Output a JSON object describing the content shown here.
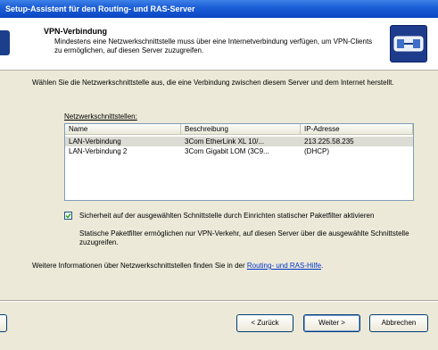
{
  "window": {
    "title": "Setup-Assistent für den Routing- und RAS-Server"
  },
  "header": {
    "title": "VPN-Verbindung",
    "description": "Mindestens eine Netzwerkschnittstelle muss über eine Internetverbindung verfügen, um VPN-Clients zu ermöglichen, auf diesen Server zuzugreifen.",
    "icon": "vpn-network-icon"
  },
  "intro": "Wählen Sie die Netzwerkschnittstelle aus, die eine Verbindung zwischen diesem Server und dem Internet herstellt.",
  "interfaces": {
    "label": "Netzwerkschnittstellen:",
    "columns": [
      "Name",
      "Beschreibung",
      "IP-Adresse"
    ],
    "rows": [
      [
        "LAN-Verbindung",
        "3Com EtherLink XL 10/...",
        "213.225.58.235"
      ],
      [
        "LAN-Verbindung 2",
        "3Com Gigabit LOM (3C9...",
        "(DHCP)"
      ]
    ]
  },
  "security": {
    "checked": true,
    "label": "Sicherheit auf der ausgewählten Schnittstelle durch Einrichten statischer Paketfilter aktivieren",
    "description": "Statische Paketfilter ermöglichen nur VPN-Verkehr, auf diesen Server über die ausgewählte Schnittstelle zuzugreifen."
  },
  "info": {
    "text": "Weitere Informationen über Netzwerkschnittstellen finden Sie in der",
    "link": "Routing- und RAS-Hilfe",
    "suffix": "."
  },
  "buttons": {
    "back": "< Zurück",
    "next": "Weiter >",
    "cancel": "Abbrechen"
  }
}
